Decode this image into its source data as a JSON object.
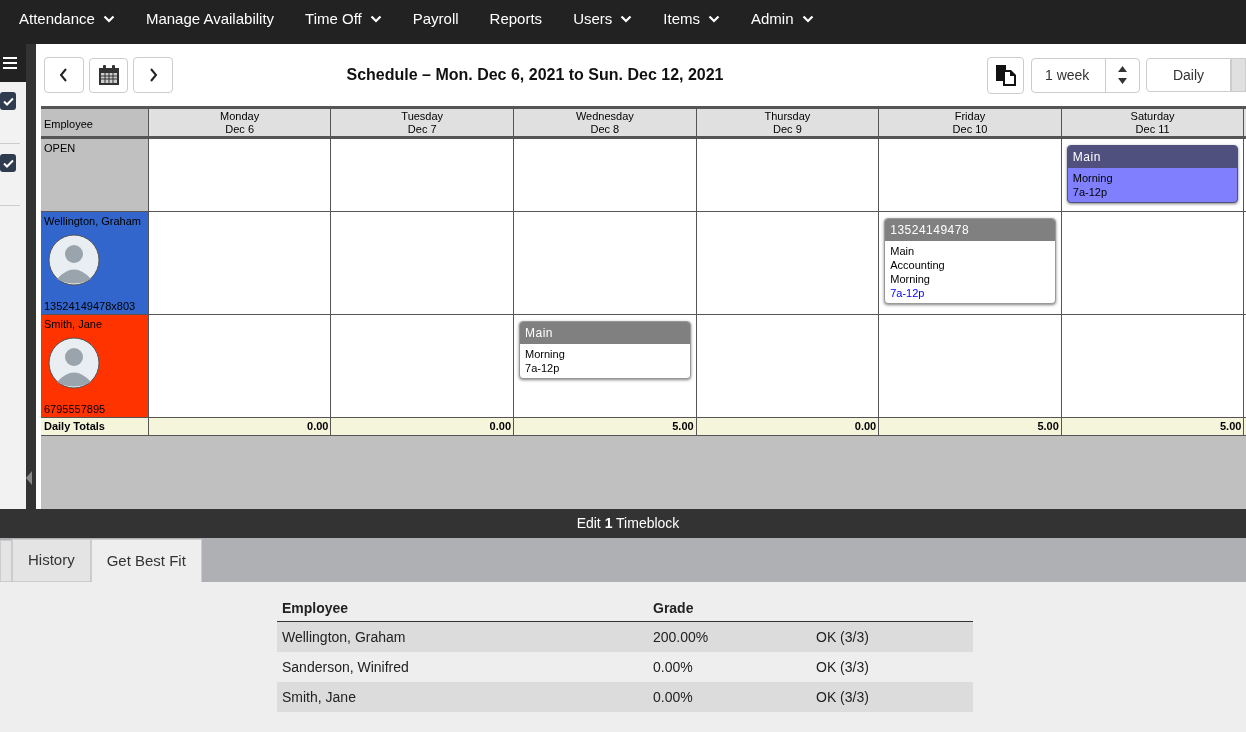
{
  "nav": {
    "items": [
      {
        "label": "Attendance",
        "dropdown": true
      },
      {
        "label": "Manage Availability",
        "dropdown": false
      },
      {
        "label": "Time Off",
        "dropdown": true
      },
      {
        "label": "Payroll",
        "dropdown": false
      },
      {
        "label": "Reports",
        "dropdown": false
      },
      {
        "label": "Users",
        "dropdown": true
      },
      {
        "label": "Items",
        "dropdown": true
      },
      {
        "label": "Admin",
        "dropdown": true
      }
    ]
  },
  "sidebar": {
    "checkboxes": [
      {
        "checked": true
      },
      {
        "checked": true
      }
    ]
  },
  "toolbar": {
    "title": "Schedule – Mon. Dec 6, 2021 to Sun. Dec 12, 2021",
    "range": "1 week",
    "view": "Daily"
  },
  "schedule": {
    "employee_header": "Employee",
    "days": [
      {
        "day": "Monday",
        "date": "Dec 6"
      },
      {
        "day": "Tuesday",
        "date": "Dec 7"
      },
      {
        "day": "Wednesday",
        "date": "Dec 8"
      },
      {
        "day": "Thursday",
        "date": "Dec 9"
      },
      {
        "day": "Friday",
        "date": "Dec 10"
      },
      {
        "day": "Saturday",
        "date": "Dec 11"
      }
    ],
    "rows": [
      {
        "kind": "open",
        "name": "OPEN",
        "cells": [
          null,
          null,
          null,
          null,
          null,
          {
            "kind": "open",
            "header": "Main",
            "lines": [
              "Morning"
            ],
            "time": "7a-12p",
            "time_link": false
          }
        ]
      },
      {
        "kind": "employee",
        "name": "Wellington, Graham",
        "phone": "13524149478x803",
        "color": "#3366cc",
        "cells": [
          null,
          null,
          null,
          null,
          {
            "kind": "assigned",
            "header": "13524149478",
            "lines": [
              "Main",
              "Accounting",
              "Morning"
            ],
            "time": "7a-12p",
            "time_link": true
          },
          null
        ]
      },
      {
        "kind": "employee",
        "name": "Smith, Jane",
        "phone": "6795557895",
        "color": "#ff3300",
        "cells": [
          null,
          null,
          {
            "kind": "assigned",
            "header": "Main",
            "lines": [
              "Morning"
            ],
            "time": "7a-12p",
            "time_link": false
          },
          null,
          null,
          null
        ]
      }
    ],
    "totals_label": "Daily Totals",
    "totals": [
      "0.00",
      "0.00",
      "5.00",
      "0.00",
      "5.00",
      "5.00"
    ]
  },
  "edit_bar": "Edit **1** Timeblock",
  "tabs": [
    {
      "label": "History",
      "selected": false
    },
    {
      "label": "Get Best Fit",
      "selected": true
    }
  ],
  "best_fit": {
    "columns": [
      "Employee",
      "Grade"
    ],
    "rows": [
      {
        "employee": "Wellington, Graham",
        "grade": "200.00%",
        "column_3": "OK (3/3)"
      },
      {
        "employee": "Sanderson, Winifred",
        "grade": "0.00%",
        "column_3": "OK (3/3)"
      },
      {
        "employee": "Smith, Jane",
        "grade": "0.00%",
        "column_3": "OK (3/3)"
      }
    ]
  }
}
